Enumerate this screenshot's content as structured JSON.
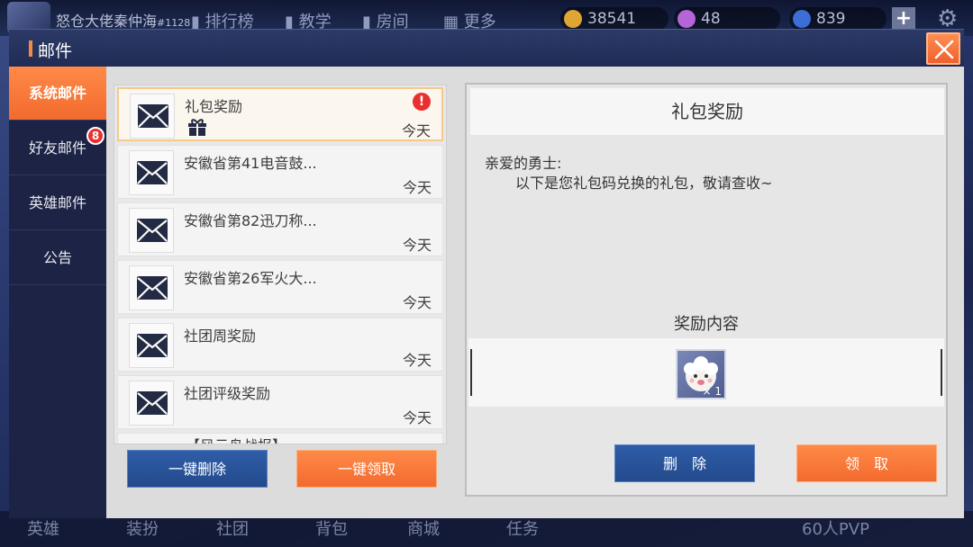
{
  "hud": {
    "player_name": "怒仓大佬秦仲海",
    "player_id": "#1128",
    "nav": [
      "排行榜",
      "教学",
      "房间",
      "更多"
    ],
    "gold": "38541",
    "gems": "48",
    "tickets": "839",
    "bottom": [
      "英雄",
      "装扮",
      "社团",
      "背包",
      "商城",
      "任务",
      "60人PVP"
    ]
  },
  "window": {
    "title": "邮件"
  },
  "sidebar": {
    "tabs": [
      {
        "label": "系统邮件",
        "active": true
      },
      {
        "label": "好友邮件",
        "badge": "8"
      },
      {
        "label": "英雄邮件"
      },
      {
        "label": "公告"
      }
    ]
  },
  "mail_list": {
    "items": [
      {
        "title": "礼包奖励",
        "date": "今天",
        "has_gift": true,
        "unread_alert": "!"
      },
      {
        "title": "安徽省第41电音鼓...",
        "date": "今天"
      },
      {
        "title": "安徽省第82迅刀称...",
        "date": "今天"
      },
      {
        "title": "安徽省第26军火大...",
        "date": "今天"
      },
      {
        "title": "社团周奖励",
        "date": "今天"
      },
      {
        "title": "社团评级奖励",
        "date": "今天"
      },
      {
        "title": "【风云岛战报】",
        "date": ""
      }
    ],
    "delete_all_label": "一键删除",
    "claim_all_label": "一键领取"
  },
  "detail": {
    "title": "礼包奖励",
    "greeting": "亲爱的勇士:",
    "message": "以下是您礼包码兑换的礼包，敬请查收~",
    "reward_label": "奖励内容",
    "reward_item": {
      "name": "sheep-avatar",
      "quantity": "× 1"
    },
    "delete_label": "删　除",
    "claim_label": "领　取"
  },
  "colors": {
    "accent": "#f26a2e",
    "blue_button": "#2f5da8",
    "alert": "#e8312f"
  }
}
